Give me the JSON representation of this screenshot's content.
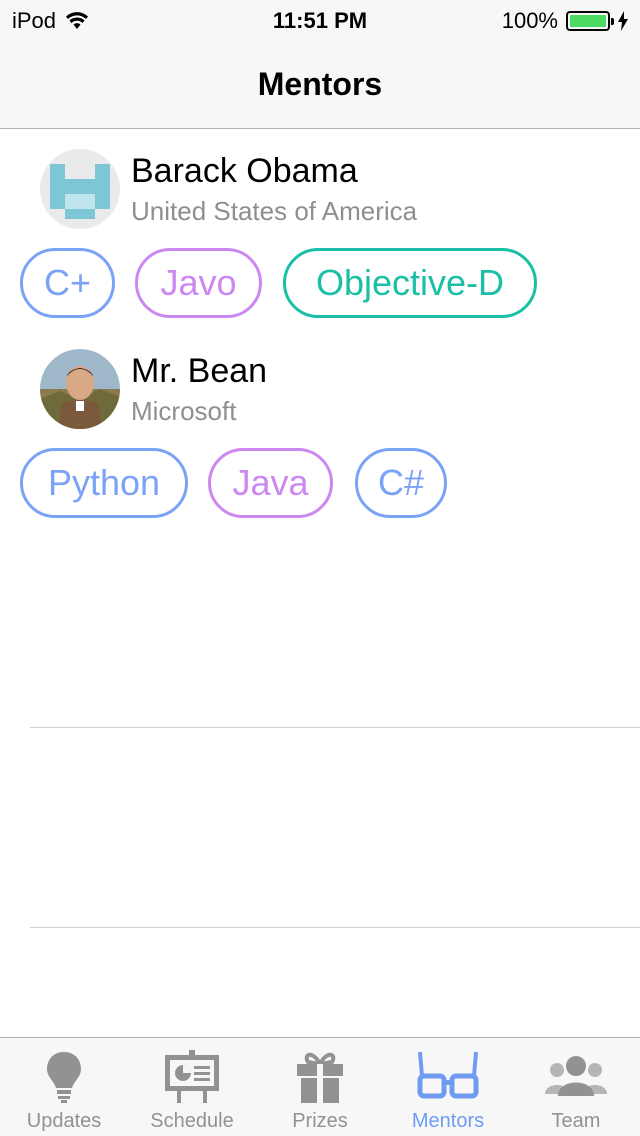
{
  "status_bar": {
    "carrier": "iPod",
    "time": "11:51 PM",
    "battery": "100%"
  },
  "nav": {
    "title": "Mentors"
  },
  "mentors": [
    {
      "name": "Barack Obama",
      "organization": "United States of America",
      "tags": [
        {
          "label": "C+",
          "color": "#7aa2f7"
        },
        {
          "label": "Javo",
          "color": "#cc88f0"
        },
        {
          "label": "Objective-D",
          "color": "#1abfa5"
        }
      ]
    },
    {
      "name": "Mr. Bean",
      "organization": "Microsoft",
      "tags": [
        {
          "label": "Python",
          "color": "#7aa2f7"
        },
        {
          "label": "Java",
          "color": "#cc88f0"
        },
        {
          "label": "C#",
          "color": "#7aa2f7"
        }
      ]
    }
  ],
  "tab_bar": {
    "active_color": "#6f9cf2",
    "inactive_color": "#929292",
    "tabs": [
      {
        "label": "Updates",
        "icon": "lightbulb-icon"
      },
      {
        "label": "Schedule",
        "icon": "presentation-board-icon"
      },
      {
        "label": "Prizes",
        "icon": "gift-icon"
      },
      {
        "label": "Mentors",
        "icon": "glasses-icon",
        "active": true
      },
      {
        "label": "Team",
        "icon": "people-icon"
      }
    ]
  }
}
